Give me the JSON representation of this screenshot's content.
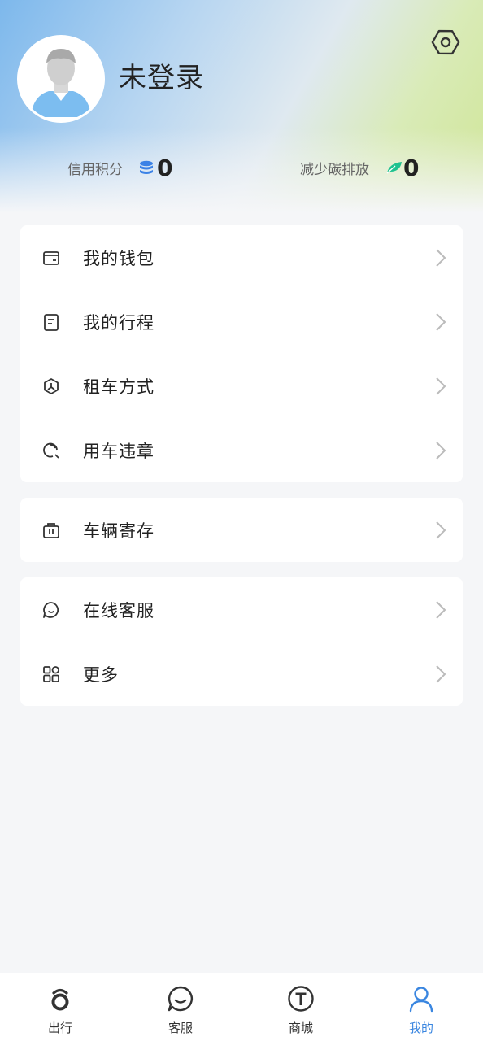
{
  "profile": {
    "username": "未登录"
  },
  "stats": {
    "credit": {
      "label": "信用积分",
      "value": "0",
      "icon": "coin-stack-icon",
      "color": "#3b82e6"
    },
    "carbon": {
      "label": "减少碳排放",
      "value": "0",
      "icon": "leaf-icon",
      "color": "#1fc28f"
    }
  },
  "menu": {
    "group1": [
      {
        "label": "我的钱包",
        "icon": "wallet-icon"
      },
      {
        "label": "我的行程",
        "icon": "itinerary-icon"
      },
      {
        "label": "租车方式",
        "icon": "rental-method-icon"
      },
      {
        "label": "用车违章",
        "icon": "violation-icon"
      }
    ],
    "group2": [
      {
        "label": "车辆寄存",
        "icon": "storage-icon"
      }
    ],
    "group3": [
      {
        "label": "在线客服",
        "icon": "chat-icon"
      },
      {
        "label": "更多",
        "icon": "grid-icon"
      }
    ]
  },
  "tabs": [
    {
      "label": "出行",
      "icon": "travel-icon"
    },
    {
      "label": "客服",
      "icon": "service-icon"
    },
    {
      "label": "商城",
      "icon": "mall-icon"
    },
    {
      "label": "我的",
      "icon": "profile-icon",
      "active": true
    }
  ],
  "colors": {
    "accent": "#3a86e0",
    "text": "#222222",
    "background": "#f5f6f8"
  }
}
